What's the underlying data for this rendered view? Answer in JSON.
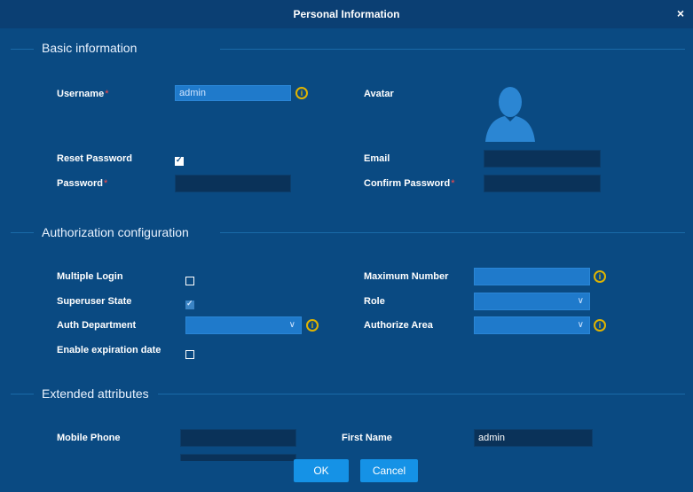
{
  "dialog": {
    "title": "Personal Information",
    "close_label": "×"
  },
  "sections": {
    "basic": "Basic information",
    "auth": "Authorization configuration",
    "extended": "Extended attributes"
  },
  "basic": {
    "username_label": "Username",
    "username_value": "admin",
    "avatar_label": "Avatar",
    "reset_password_label": "Reset Password",
    "reset_password_checked": true,
    "email_label": "Email",
    "email_value": "",
    "password_label": "Password",
    "password_value": "",
    "confirm_password_label": "Confirm Password",
    "confirm_password_value": ""
  },
  "auth": {
    "multiple_login_label": "Multiple Login",
    "multiple_login_checked": false,
    "maximum_number_label": "Maximum Number",
    "maximum_number_value": "",
    "superuser_state_label": "Superuser State",
    "superuser_state_checked": true,
    "role_label": "Role",
    "auth_department_label": "Auth Department",
    "authorize_area_label": "Authorize Area",
    "enable_expiration_label": "Enable expiration date",
    "enable_expiration_checked": false
  },
  "extended": {
    "mobile_phone_label": "Mobile Phone",
    "mobile_phone_value": "",
    "first_name_label": "First Name",
    "first_name_value": "admin"
  },
  "footer": {
    "ok_label": "OK",
    "cancel_label": "Cancel"
  },
  "colors": {
    "background": "#0a4a82",
    "accent": "#1592e6",
    "info": "#e0b400",
    "required": "#ff4a4a"
  }
}
